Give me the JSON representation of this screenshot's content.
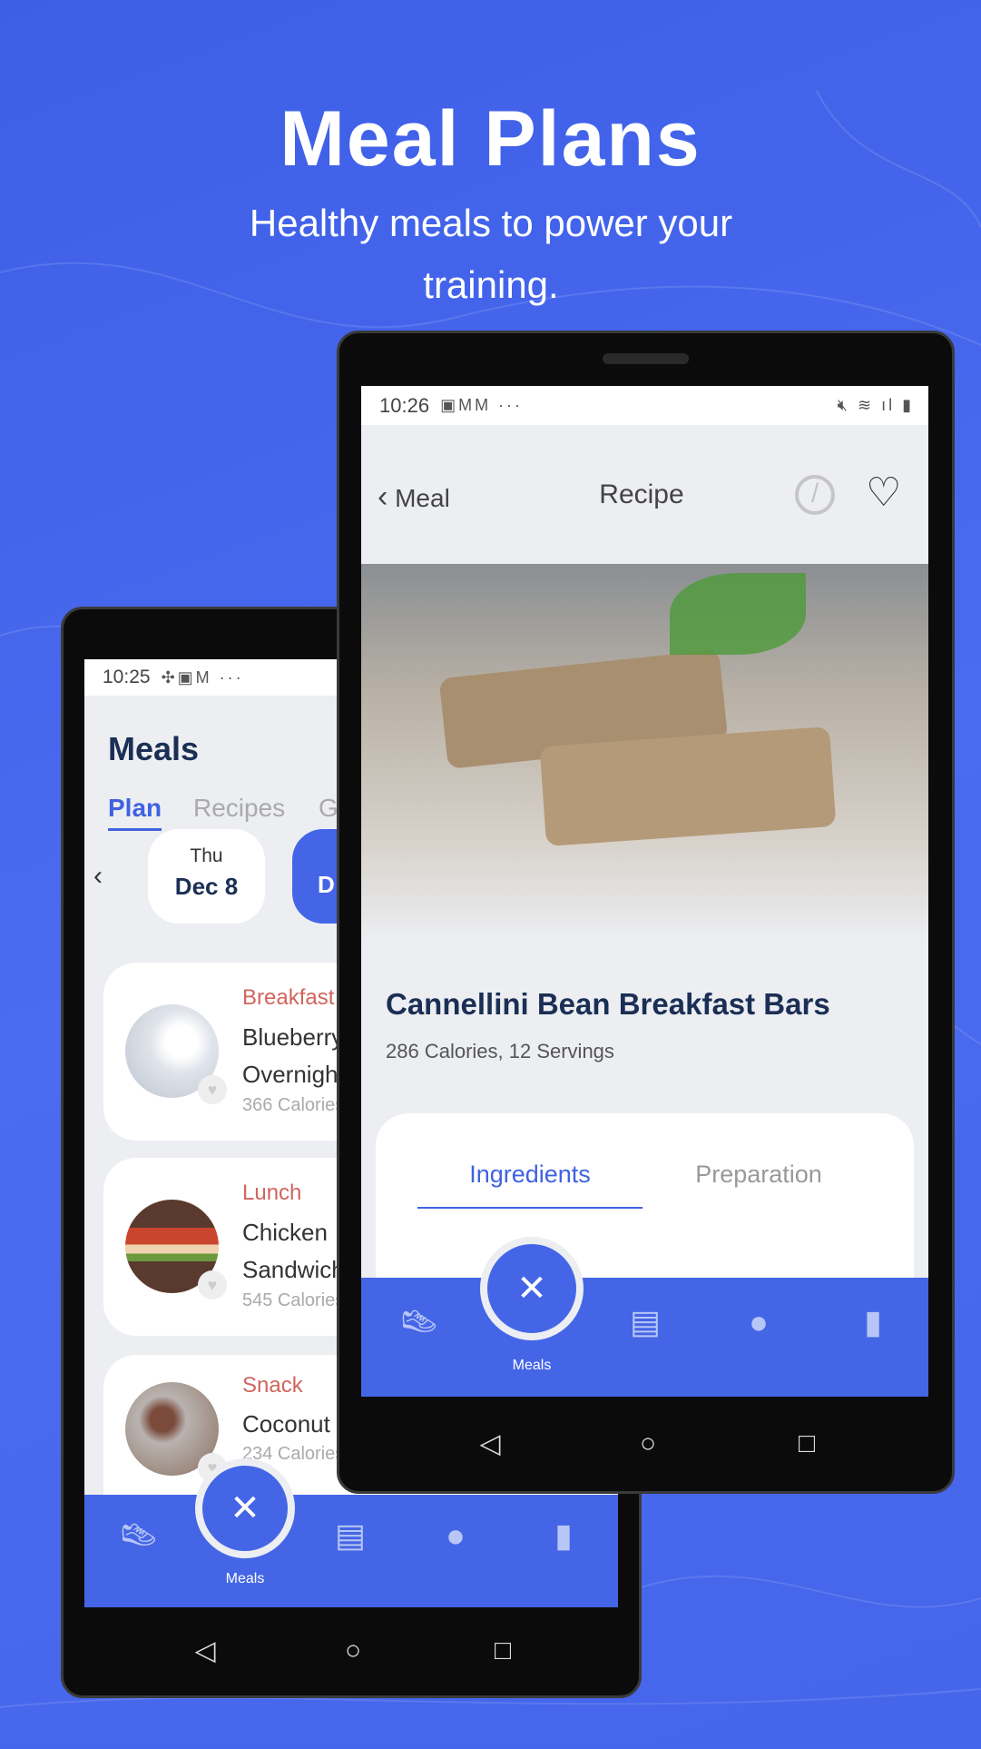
{
  "hero": {
    "title": "Meal Plans",
    "subtitle": "Healthy meals to power your training."
  },
  "back_phone": {
    "status": {
      "time": "10:25"
    },
    "page_title": "Meals",
    "tabs": [
      {
        "label": "Plan",
        "active": true
      },
      {
        "label": "Recipes"
      },
      {
        "label": "G"
      }
    ],
    "date": {
      "day": "Thu",
      "date": "Dec 8",
      "next_partial": "D"
    },
    "meals": [
      {
        "type": "Breakfast",
        "name_line1": "Blueberry",
        "name_line2": "Overnight",
        "calories": "366 Calories"
      },
      {
        "type": "Lunch",
        "name_line1": "Chicken",
        "name_line2": "Sandwich",
        "calories": "545 Calories"
      },
      {
        "type": "Snack",
        "name_line1": "Coconut",
        "name_line2": "",
        "calories": "234 Calories"
      }
    ],
    "nav": {
      "active_label": "Meals"
    }
  },
  "front_phone": {
    "status": {
      "time": "10:26"
    },
    "header": {
      "back_label": "Meal",
      "title": "Recipe"
    },
    "recipe": {
      "title": "Cannellini Bean Breakfast Bars",
      "meta": "286 Calories, 12 Servings"
    },
    "tabs": [
      {
        "label": "Ingredients",
        "active": true
      },
      {
        "label": "Preparation"
      }
    ],
    "nav": {
      "active_label": "Meals"
    }
  },
  "colors": {
    "accent": "#4466e6",
    "meal_type": "#d0655e",
    "title_dark": "#1b2f55"
  }
}
